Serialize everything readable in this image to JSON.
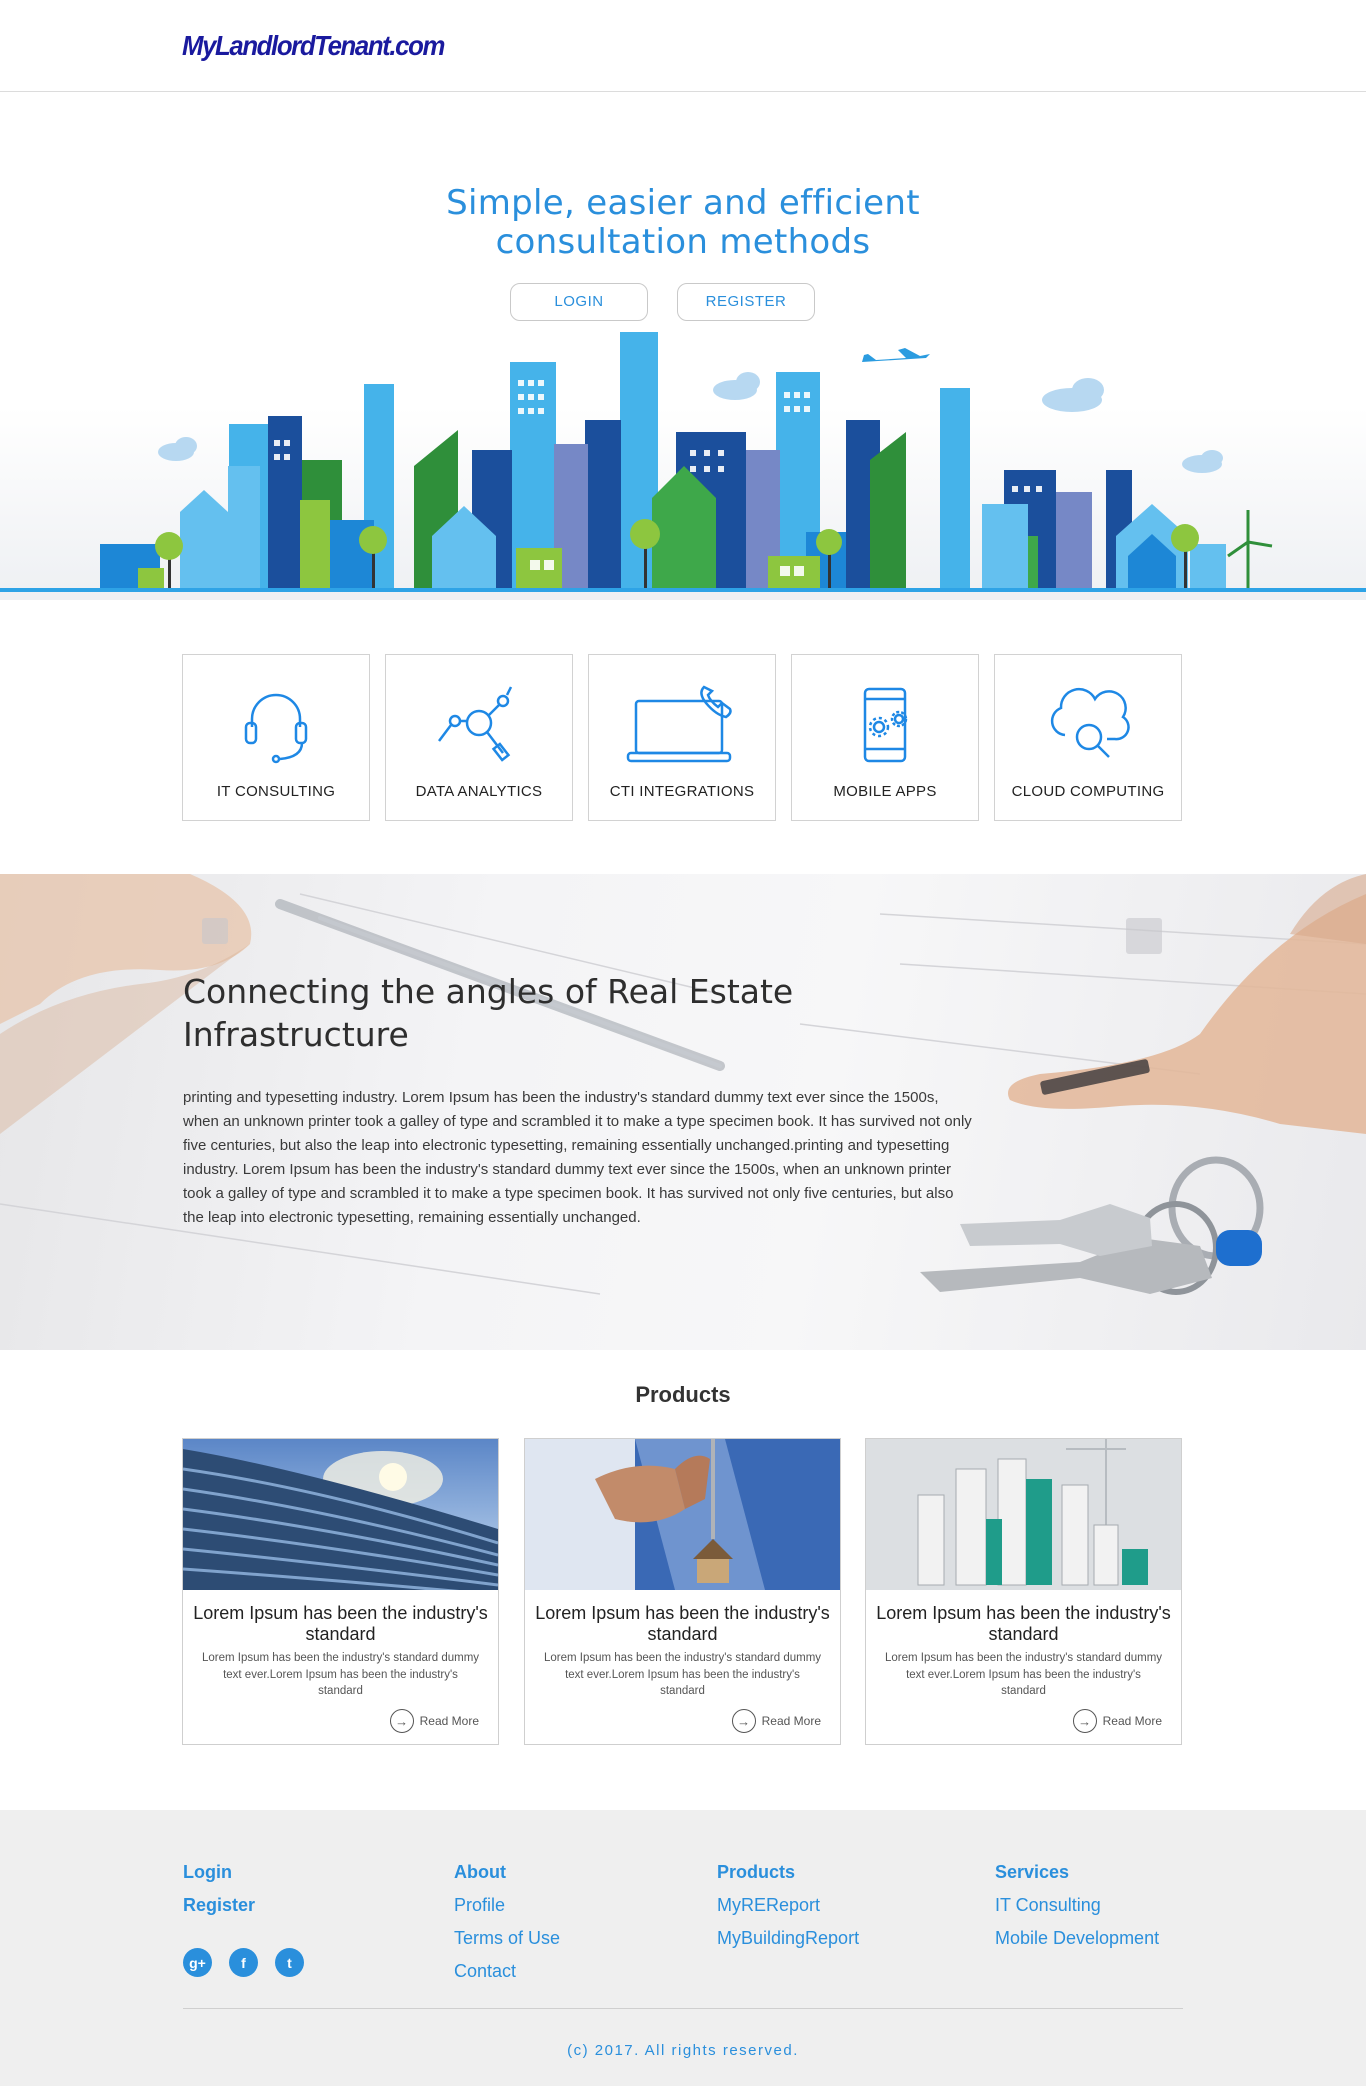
{
  "brand": {
    "logo": "MyLandlordTenant.com",
    "accent": "#2a8fdc"
  },
  "hero": {
    "title_line1": "Simple, easier and efficient",
    "title_line2": "consultation methods",
    "login": "LOGIN",
    "register": "REGISTER"
  },
  "services": [
    {
      "label": "IT CONSULTING",
      "icon": "headset-icon"
    },
    {
      "label": "DATA ANALYTICS",
      "icon": "analytics-icon"
    },
    {
      "label": "CTI INTEGRATIONS",
      "icon": "laptop-phone-icon"
    },
    {
      "label": "MOBILE APPS",
      "icon": "mobile-gears-icon"
    },
    {
      "label": "CLOUD COMPUTING",
      "icon": "cloud-search-icon"
    }
  ],
  "banner": {
    "title": "Connecting the angles of Real Estate Infrastructure",
    "text": "printing and typesetting industry. Lorem Ipsum has been the industry's standard dummy text ever since the 1500s, when an unknown printer took a galley of type and scrambled it to make a type specimen book. It has survived not only five centuries, but also the leap into electronic typesetting, remaining essentially unchanged.printing and typesetting industry. Lorem Ipsum has been the industry's standard dummy text ever since the 1500s, when an unknown printer took a galley of type and scrambled it to make a type specimen book. It has survived not only five centuries, but also the leap into electronic typesetting, remaining essentially unchanged."
  },
  "products": {
    "heading": "Products",
    "cards": [
      {
        "title": "Lorem Ipsum has been the industry's standard",
        "desc": "Lorem Ipsum has been the industry's standard dummy text ever.Lorem Ipsum has been the industry's standard",
        "more": "Read More"
      },
      {
        "title": "Lorem Ipsum has been the industry's standard",
        "desc": "Lorem Ipsum has been the industry's standard dummy text ever.Lorem Ipsum has been the industry's standard",
        "more": "Read More"
      },
      {
        "title": "Lorem Ipsum has been the industry's standard",
        "desc": "Lorem Ipsum has been the industry's standard dummy text ever.Lorem Ipsum has been the industry's standard",
        "more": "Read More"
      }
    ]
  },
  "footer": {
    "col1": {
      "login": "Login",
      "register": "Register"
    },
    "col2": {
      "about": "About",
      "profile": "Profile",
      "terms": "Terms of Use",
      "contact": "Contact"
    },
    "col3": {
      "products": "Products",
      "myrereport": "MyREReport",
      "mybuildingreport": "MyBuildingReport"
    },
    "col4": {
      "services": "Services",
      "it_consulting": "IT Consulting",
      "mobile_dev": "Mobile Development"
    },
    "social": {
      "gplus": "g+",
      "facebook": "f",
      "twitter": "t"
    },
    "copyright": "(c) 2017. All rights reserved."
  }
}
